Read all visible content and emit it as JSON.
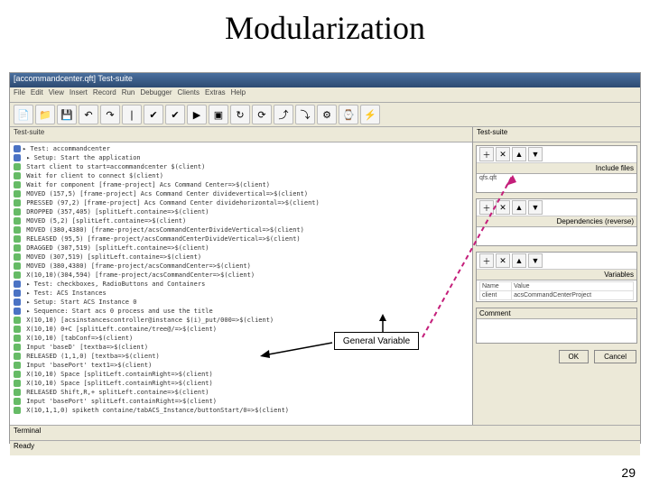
{
  "title": "Modularization",
  "page_number": "29",
  "callout_label": "General Variable",
  "app": {
    "window_title": "[accommandcenter.qft] Test-suite",
    "menu": [
      "File",
      "Edit",
      "View",
      "Insert",
      "Record",
      "Run",
      "Debugger",
      "Clients",
      "Extras",
      "Help"
    ],
    "left_header": "Test-suite",
    "right_header": "Test-suite",
    "terminal_label": "Terminal",
    "status": "Ready"
  },
  "toolbar_icons": [
    "📄",
    "📁",
    "💾",
    "↶",
    "↷",
    "❘",
    "✔",
    "✔",
    "▶",
    "▣",
    "↻",
    "⟳",
    "⤴",
    "⤵",
    "⚙",
    "⌚",
    "⚡"
  ],
  "tree_lines": [
    "▸ Test: accommandcenter",
    "  ▸ Setup: Start the application",
    "    Start client to start=accommandcenter $(client)",
    "    Wait for client to connect $(client)",
    "    Wait for component [frame-project]  Acs Command Center=>$(client)",
    "    MOVED (157,5) [frame-project]  Acs Command Center dividevertical=>$(client)",
    "    PRESSED (97,2) [frame-project]  Acs Command Center dividehorizontal=>$(client)",
    "    DROPPED (357,405) [splitLeft.containe=>$(client)",
    "    MOVED (5,2) [splitLeft.containe=>$(client)",
    "    MOVED (380,4380) [frame-project/acsCommandCenterDivideVertical=>$(client)",
    "    RELEASED (95,5) [frame-project/acsCommandCenterDivideVertical=>$(client)",
    "    DRAGGED (307,519) [splitLeft.containe=>$(client)",
    "    MOVED (307,519) [splitLeft.containe=>$(client)",
    "    MOVED (380,4380) [frame-project/acsCommandCenter=>$(client)",
    "    X(10,10)(304,594) [frame-project/acsCommandCenter=>$(client)",
    "  ▸ Test: checkboxes, RadioButtons and Containers",
    "  ▸ Test: ACS Instances",
    "    ▸ Setup: Start ACS Instance 0",
    "      ▸ Sequence: Start acs 0 process and use the title",
    "        X(10,10) [acsinstancescontroller@instance $(i)_put/000=>$(client)",
    "        X(10,10) 0+C [splitLeft.containe/tree@/=>$(client)",
    "        X(10,10) [tabConf=>$(client)",
    "        Input 'baseD' [textba=>$(client)",
    "        RELEASED (1,1,0) [textba=>$(client)",
    "        Input 'basePort' text1=>$(client)",
    "        X(10,10) Space [splitLeft.containRight=>$(client)",
    "        X(10,10) Space [splitLeft.containRight=>$(client)",
    "        RELEASED Shift,R,+ splitLeft.containe=>$(client)",
    "        Input 'basePort' splitLeft.containRight=>$(client)",
    "        X(10,1,1,0) spiketh containe/tabACS_Instance/buttonStart/0=>$(client)"
  ],
  "panels": {
    "include": {
      "title": "Include files",
      "body": "qfs.qft"
    },
    "deps": {
      "title": "Dependencies (reverse)",
      "body": ""
    },
    "vars": {
      "title": "Variables",
      "headers": [
        "Name",
        "Value"
      ],
      "row": [
        "client",
        "acsCommandCenterProject"
      ]
    },
    "comment": {
      "title": "Comment",
      "body": ""
    }
  },
  "mini_tool_icons": [
    "＋",
    "✕",
    "▲",
    "▼"
  ],
  "buttons": {
    "ok": "OK",
    "cancel": "Cancel"
  }
}
